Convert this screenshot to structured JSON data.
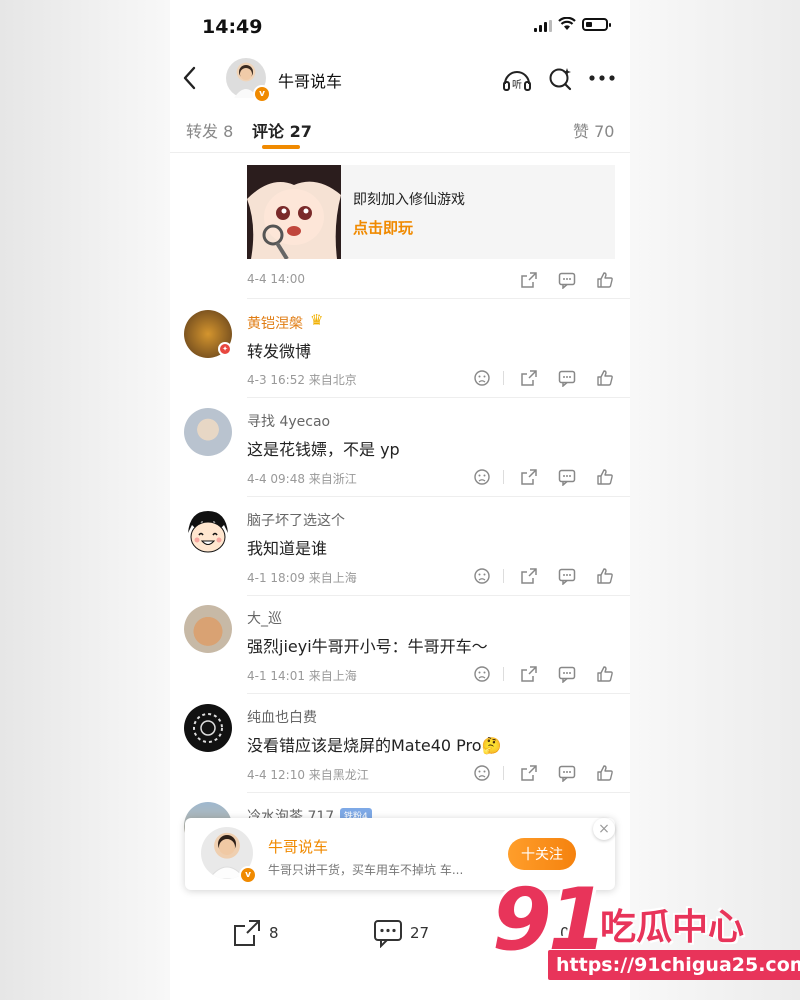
{
  "status": {
    "time": "14:49"
  },
  "nav": {
    "title": "牛哥说车",
    "listen_label": "听"
  },
  "tabs": {
    "repost": "转发 8",
    "comments": "评论 27",
    "likes": "赞 70"
  },
  "ad_card": {
    "title": "即刻加入修仙游戏",
    "action": "点击即玩",
    "date": "4-4 14:00"
  },
  "comments": [
    {
      "name": "黄铠涅槃",
      "text": "转发微博",
      "meta": "4-3 16:52  来自北京",
      "vip": true
    },
    {
      "name": "寻找 4yecao",
      "text": "这是花钱嫖，不是 yp",
      "meta": "4-4 09:48  来自浙江"
    },
    {
      "name": "脑子坏了选这个",
      "text": "我知道是谁",
      "meta": "4-1 18:09  来自上海"
    },
    {
      "name": "大_巡",
      "text": "强烈jieyi牛哥开小号：牛哥开车～",
      "meta": "4-1 14:01  来自上海"
    },
    {
      "name": "纯血也白费",
      "text": "没看错应该是烧屏的Mate40 Pro🤔",
      "meta": "4-4 12:10  来自黑龙江"
    },
    {
      "name": "冷水泡茶 717",
      "rank": "铁粉4"
    }
  ],
  "popup": {
    "name": "牛哥说车",
    "desc": "牛哥只讲干货，买车用车不掉坑 车...",
    "follow": "十关注"
  },
  "bottom": {
    "repost_count": "8",
    "comment_count": "27",
    "like_count": "0"
  },
  "watermark": {
    "number": "91",
    "text": "吃瓜中心",
    "url": "https://91chigua25.com"
  },
  "colors": {
    "accent": "#f08a00",
    "watermark": "#e8345a"
  }
}
